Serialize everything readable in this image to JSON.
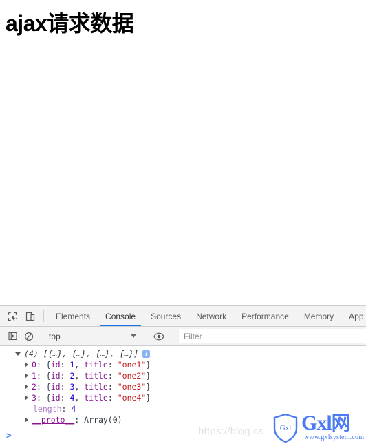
{
  "page": {
    "title": "ajax请求数据"
  },
  "devtools": {
    "toolbar_icons": [
      {
        "name": "inspect-element-icon"
      },
      {
        "name": "device-toolbar-icon"
      }
    ],
    "tabs": [
      {
        "label": "Elements",
        "active": false
      },
      {
        "label": "Console",
        "active": true
      },
      {
        "label": "Sources",
        "active": false
      },
      {
        "label": "Network",
        "active": false
      },
      {
        "label": "Performance",
        "active": false
      },
      {
        "label": "Memory",
        "active": false
      },
      {
        "label": "App",
        "active": false
      }
    ],
    "console_toolbar": {
      "sidebar_toggle_icon": "console-sidebar-icon",
      "clear_icon": "clear-console-icon",
      "context_selected": "top",
      "eye_icon": "live-expression-icon",
      "filter_placeholder": "Filter",
      "filter_value": ""
    },
    "console_output": {
      "array_preview": "(4) [{…}, {…}, {…}, {…}]",
      "info_badge": "i",
      "entries": [
        {
          "index": "0",
          "open_brace": ": {",
          "key1": "id",
          "val1": "1",
          "sep": ", ",
          "key2": "title",
          "val2": "\"one1\"",
          "close_brace": "}"
        },
        {
          "index": "1",
          "open_brace": ": {",
          "key1": "id",
          "val1": "2",
          "sep": ", ",
          "key2": "title",
          "val2": "\"one2\"",
          "close_brace": "}"
        },
        {
          "index": "2",
          "open_brace": ": {",
          "key1": "id",
          "val1": "3",
          "sep": ", ",
          "key2": "title",
          "val2": "\"one3\"",
          "close_brace": "}"
        },
        {
          "index": "3",
          "open_brace": ": {",
          "key1": "id",
          "val1": "4",
          "sep": ", ",
          "key2": "title",
          "val2": "\"one4\"",
          "close_brace": "}"
        }
      ],
      "length_key": "length",
      "length_value": "4",
      "proto_key": "__proto__",
      "proto_value": "Array(0)"
    },
    "prompt": {
      "caret": ">",
      "value": ""
    }
  },
  "watermark": {
    "url_text": "https://blog.cs"
  },
  "logo": {
    "shield_text": "Gxl",
    "main_text_latin": "Gxl",
    "main_text_cn": "网",
    "sub_text": "www.gxlsystem.com"
  },
  "colors": {
    "accent_blue": "#1a73e8",
    "string_red": "#c41a16",
    "key_purple": "#881391",
    "number_blue": "#1c00cf",
    "logo_blue": "#4a7bf2"
  }
}
